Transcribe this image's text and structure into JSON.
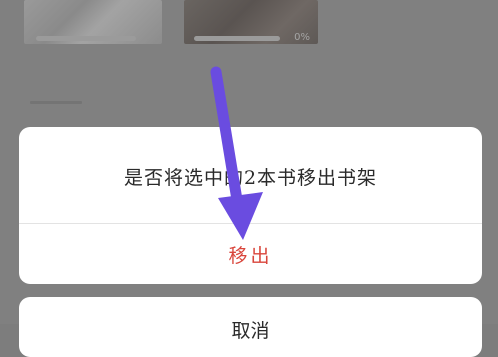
{
  "background": {
    "books": [
      {
        "progress_label": ""
      },
      {
        "progress_label": "0%"
      }
    ]
  },
  "dialog": {
    "message": "是否将选中的2本书移出书架",
    "confirm_label": "移出",
    "cancel_label": "取消"
  },
  "annotation": {
    "arrow_color": "#6a4ce0",
    "arrow_icon": "down-arrow-icon"
  },
  "colors": {
    "confirm_text": "#d9453b",
    "overlay": "#808080"
  }
}
